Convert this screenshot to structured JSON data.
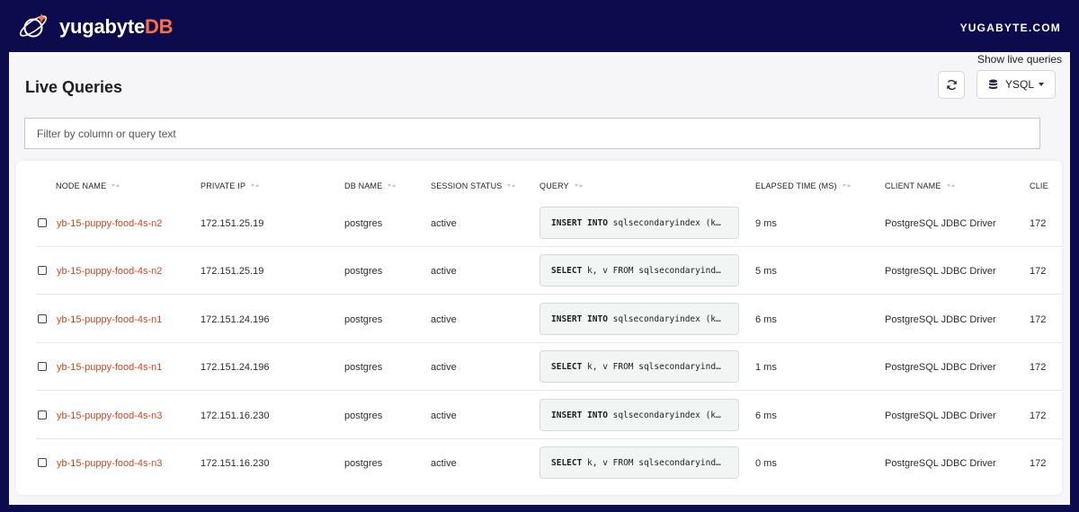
{
  "header": {
    "brand_main": "yugabyte",
    "brand_accent": "DB",
    "site_link": "YUGABYTE.COM"
  },
  "page": {
    "title": "Live Queries",
    "show_live_queries": "Show live queries",
    "db_selector": "YSQL",
    "filter_placeholder": "Filter by column or query text"
  },
  "table": {
    "columns": [
      "NODE NAME",
      "PRIVATE IP",
      "DB NAME",
      "SESSION STATUS",
      "QUERY",
      "ELAPSED TIME (MS)",
      "CLIENT NAME",
      "CLIE"
    ],
    "rows": [
      {
        "node": "yb-15-puppy-food-4s-n2",
        "ip": "172.151.25.19",
        "db": "postgres",
        "status": "active",
        "query_kw": "INSERT INTO",
        "query_rest": " sqlsecondaryindex (k…",
        "elapsed": "9 ms",
        "client": "PostgreSQL JDBC Driver",
        "client_host": "172"
      },
      {
        "node": "yb-15-puppy-food-4s-n2",
        "ip": "172.151.25.19",
        "db": "postgres",
        "status": "active",
        "query_kw": "SELECT",
        "query_rest": " k, v FROM sqlsecondaryind…",
        "elapsed": "5 ms",
        "client": "PostgreSQL JDBC Driver",
        "client_host": "172"
      },
      {
        "node": "yb-15-puppy-food-4s-n1",
        "ip": "172.151.24.196",
        "db": "postgres",
        "status": "active",
        "query_kw": "INSERT INTO",
        "query_rest": " sqlsecondaryindex (k…",
        "elapsed": "6 ms",
        "client": "PostgreSQL JDBC Driver",
        "client_host": "172"
      },
      {
        "node": "yb-15-puppy-food-4s-n1",
        "ip": "172.151.24.196",
        "db": "postgres",
        "status": "active",
        "query_kw": "SELECT",
        "query_rest": " k, v FROM sqlsecondaryind…",
        "elapsed": "1 ms",
        "client": "PostgreSQL JDBC Driver",
        "client_host": "172"
      },
      {
        "node": "yb-15-puppy-food-4s-n3",
        "ip": "172.151.16.230",
        "db": "postgres",
        "status": "active",
        "query_kw": "INSERT INTO",
        "query_rest": " sqlsecondaryindex (k…",
        "elapsed": "6 ms",
        "client": "PostgreSQL JDBC Driver",
        "client_host": "172"
      },
      {
        "node": "yb-15-puppy-food-4s-n3",
        "ip": "172.151.16.230",
        "db": "postgres",
        "status": "active",
        "query_kw": "SELECT",
        "query_rest": " k, v FROM sqlsecondaryind…",
        "elapsed": "0 ms",
        "client": "PostgreSQL JDBC Driver",
        "client_host": "172"
      }
    ]
  },
  "icons": {
    "logo": "planet-orbit-logo",
    "refresh": "refresh-icon",
    "database": "database-icon",
    "sort": "sort-icon",
    "dropdown": "caret-down-icon"
  },
  "colors": {
    "nav_bg": "#0b0b4d",
    "brand_accent": "#ff6e42",
    "node_link": "#d8431e",
    "query_bg": "#f1f5f4"
  }
}
